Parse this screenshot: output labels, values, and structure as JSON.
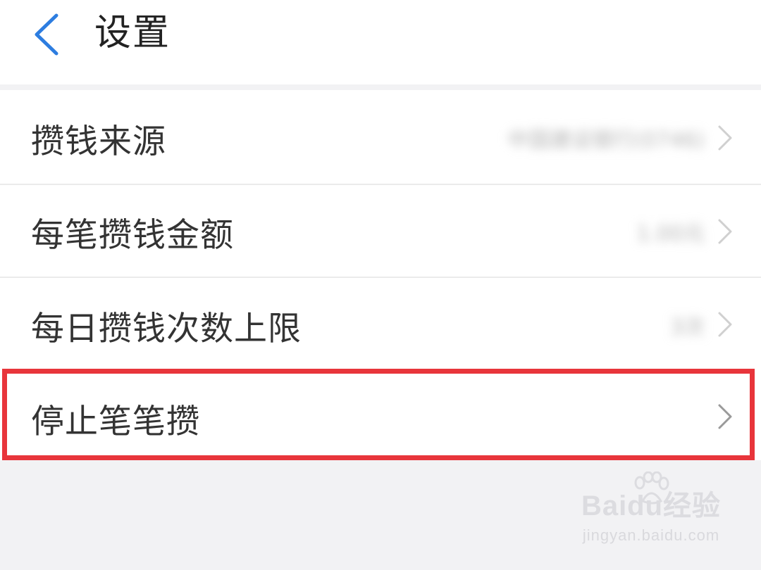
{
  "header": {
    "title": "设置",
    "back_icon": "chevron-left-icon",
    "accent_color": "#2d7de0"
  },
  "settings": {
    "items": [
      {
        "label": "攒钱来源",
        "value": "中国建设银行(0746)"
      },
      {
        "label": "每笔攒钱金额",
        "value": "1.00元"
      },
      {
        "label": "每日攒钱次数上限",
        "value": "3次"
      },
      {
        "label": "停止笔笔攒",
        "value": ""
      }
    ],
    "chevron_icon": "chevron-right-icon"
  },
  "highlight": {
    "color": "#e8353b"
  },
  "watermark": {
    "brand": "Baidu经验",
    "url": "jingyan.baidu.com"
  }
}
